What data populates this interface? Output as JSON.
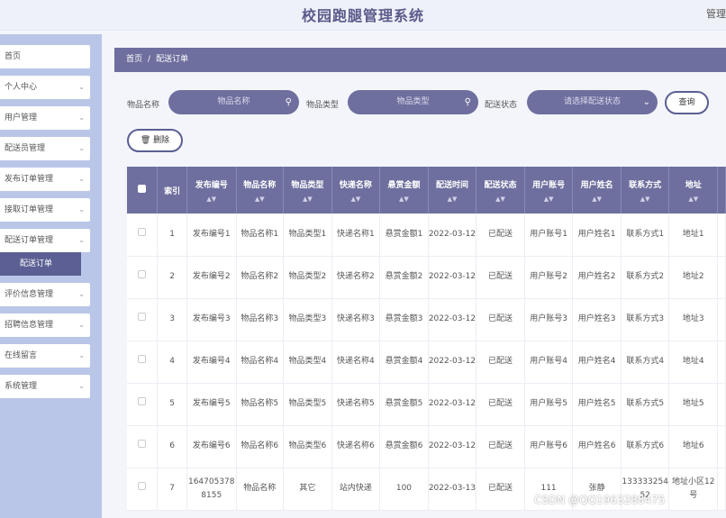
{
  "header": {
    "title": "校园跑腿管理系统",
    "admin": "管理"
  },
  "sidebar": {
    "items": [
      {
        "label": "首页",
        "chevron": false
      },
      {
        "label": "个人中心",
        "chevron": true
      },
      {
        "label": "用户管理",
        "chevron": true
      },
      {
        "label": "配送员管理",
        "chevron": true
      },
      {
        "label": "发布订单管理",
        "chevron": true
      },
      {
        "label": "接取订单管理",
        "chevron": true
      },
      {
        "label": "配送订单管理",
        "chevron": true
      },
      {
        "label": "评价信息管理",
        "chevron": true
      },
      {
        "label": "招聘信息管理",
        "chevron": true
      },
      {
        "label": "在线留言",
        "chevron": true
      },
      {
        "label": "系统管理",
        "chevron": true
      }
    ],
    "active_sub": "配送订单"
  },
  "breadcrumb": {
    "home": "首页",
    "sep": "/",
    "current": "配送订单"
  },
  "search": {
    "name_label": "物品名称",
    "name_placeholder": "物品名称",
    "type_label": "物品类型",
    "type_placeholder": "物品类型",
    "status_label": "配送状态",
    "status_placeholder": "请选择配送状态",
    "query_button": "查询",
    "delete_button": "删除"
  },
  "icons": {
    "search": "search-icon",
    "chevron": "chevron-down-icon",
    "delete": "trash-icon",
    "sort": "sort-icon"
  },
  "table": {
    "columns": [
      "索引",
      "发布编号",
      "物品名称",
      "物品类型",
      "快递名称",
      "悬赏金额",
      "配送时间",
      "配送状态",
      "用户账号",
      "用户姓名",
      "联系方式",
      "地址"
    ],
    "rows": [
      [
        "1",
        "发布编号1",
        "物品名称1",
        "物品类型1",
        "快递名称1",
        "悬赏金额1",
        "2022-03-12",
        "已配送",
        "用户账号1",
        "用户姓名1",
        "联系方式1",
        "地址1"
      ],
      [
        "2",
        "发布编号2",
        "物品名称2",
        "物品类型2",
        "快递名称2",
        "悬赏金额2",
        "2022-03-12",
        "已配送",
        "用户账号2",
        "用户姓名2",
        "联系方式2",
        "地址2"
      ],
      [
        "3",
        "发布编号3",
        "物品名称3",
        "物品类型3",
        "快递名称3",
        "悬赏金额3",
        "2022-03-12",
        "已配送",
        "用户账号3",
        "用户姓名3",
        "联系方式3",
        "地址3"
      ],
      [
        "4",
        "发布编号4",
        "物品名称4",
        "物品类型4",
        "快递名称4",
        "悬赏金额4",
        "2022-03-12",
        "已配送",
        "用户账号4",
        "用户姓名4",
        "联系方式4",
        "地址4"
      ],
      [
        "5",
        "发布编号5",
        "物品名称5",
        "物品类型5",
        "快递名称5",
        "悬赏金额5",
        "2022-03-12",
        "已配送",
        "用户账号5",
        "用户姓名5",
        "联系方式5",
        "地址5"
      ],
      [
        "6",
        "发布编号6",
        "物品名称6",
        "物品类型6",
        "快递名称6",
        "悬赏金额6",
        "2022-03-12",
        "已配送",
        "用户账号6",
        "用户姓名6",
        "联系方式6",
        "地址6"
      ],
      [
        "7",
        "1647053788155",
        "物品名称",
        "其它",
        "站内快递",
        "100",
        "2022-03-13",
        "已配送",
        "111",
        "张静",
        "13333325452",
        "地址小区12号"
      ]
    ]
  },
  "watermark": "CSDN @QQ1963288475",
  "colors": {
    "primary": "#6e6f9e",
    "sidebar": "#b9c6e8",
    "active": "#5b5f93"
  }
}
